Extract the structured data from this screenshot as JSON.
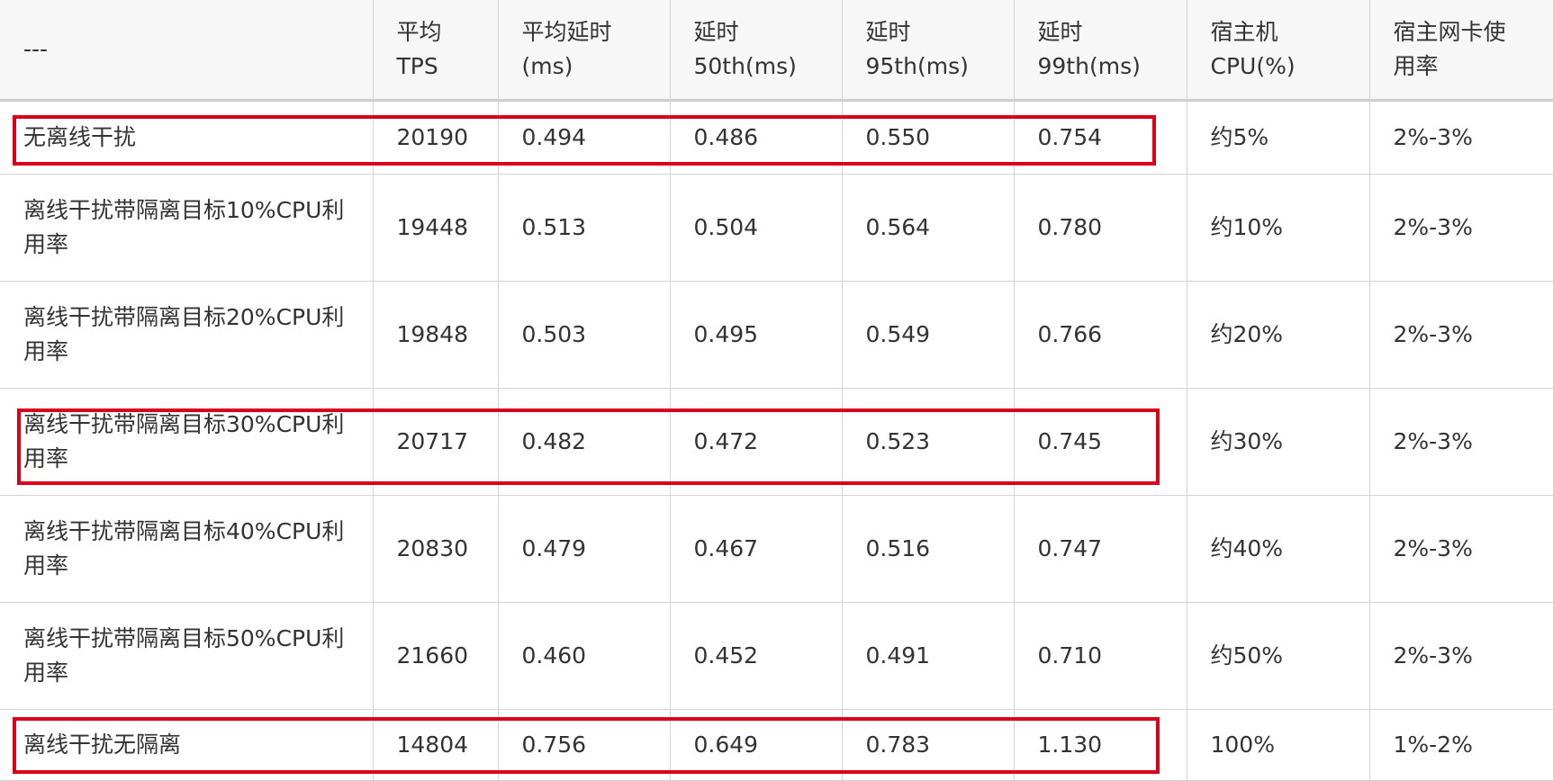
{
  "table": {
    "headers": [
      [
        "---"
      ],
      [
        "平均",
        "TPS"
      ],
      [
        "平均延时",
        "(ms)"
      ],
      [
        "延时",
        "50th(ms)"
      ],
      [
        "延时",
        "95th(ms)"
      ],
      [
        "延时",
        "99th(ms)"
      ],
      [
        "宿主机",
        "CPU(%)"
      ],
      [
        "宿主网卡使",
        "用率"
      ]
    ],
    "rows": [
      {
        "scenario": "无离线干扰",
        "tps": "20190",
        "avg": "0.494",
        "p50": "0.486",
        "p95": "0.550",
        "p99": "0.754",
        "host_cpu": "约5%",
        "nic": "2%-3%",
        "highlighted": true
      },
      {
        "scenario": "离线干扰带隔离目标10%CPU利用率",
        "tps": "19448",
        "avg": "0.513",
        "p50": "0.504",
        "p95": "0.564",
        "p99": "0.780",
        "host_cpu": "约10%",
        "nic": "2%-3%",
        "highlighted": false
      },
      {
        "scenario": "离线干扰带隔离目标20%CPU利用率",
        "tps": "19848",
        "avg": "0.503",
        "p50": "0.495",
        "p95": "0.549",
        "p99": "0.766",
        "host_cpu": "约20%",
        "nic": "2%-3%",
        "highlighted": false
      },
      {
        "scenario": "离线干扰带隔离目标30%CPU利用率",
        "tps": "20717",
        "avg": "0.482",
        "p50": "0.472",
        "p95": "0.523",
        "p99": "0.745",
        "host_cpu": "约30%",
        "nic": "2%-3%",
        "highlighted": true
      },
      {
        "scenario": "离线干扰带隔离目标40%CPU利用率",
        "tps": "20830",
        "avg": "0.479",
        "p50": "0.467",
        "p95": "0.516",
        "p99": "0.747",
        "host_cpu": "约40%",
        "nic": "2%-3%",
        "highlighted": false
      },
      {
        "scenario": "离线干扰带隔离目标50%CPU利用率",
        "tps": "21660",
        "avg": "0.460",
        "p50": "0.452",
        "p95": "0.491",
        "p99": "0.710",
        "host_cpu": "约50%",
        "nic": "2%-3%",
        "highlighted": false
      },
      {
        "scenario": "离线干扰无隔离",
        "tps": "14804",
        "avg": "0.756",
        "p50": "0.649",
        "p95": "0.783",
        "p99": "1.130",
        "host_cpu": "100%",
        "nic": "1%-2%",
        "highlighted": true
      }
    ],
    "highlight_color": "#d9001b"
  }
}
